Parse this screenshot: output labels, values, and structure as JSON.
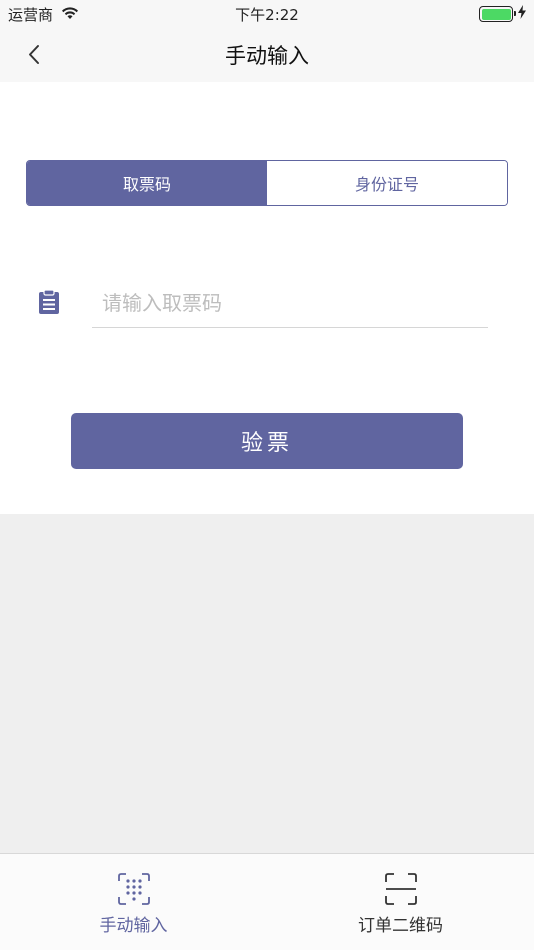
{
  "status_bar": {
    "carrier": "运营商",
    "time": "下午2:22"
  },
  "nav": {
    "title": "手动输入"
  },
  "segments": [
    {
      "label": "取票码",
      "active": true
    },
    {
      "label": "身份证号",
      "active": false
    }
  ],
  "form": {
    "placeholder": "请输入取票码",
    "value": ""
  },
  "verify_button": {
    "label": "验票"
  },
  "tabs": [
    {
      "label": "手动输入",
      "active": true
    },
    {
      "label": "订单二维码",
      "active": false
    }
  ],
  "colors": {
    "accent": "#6065a0",
    "battery": "#4cd964",
    "background": "#efefef"
  }
}
